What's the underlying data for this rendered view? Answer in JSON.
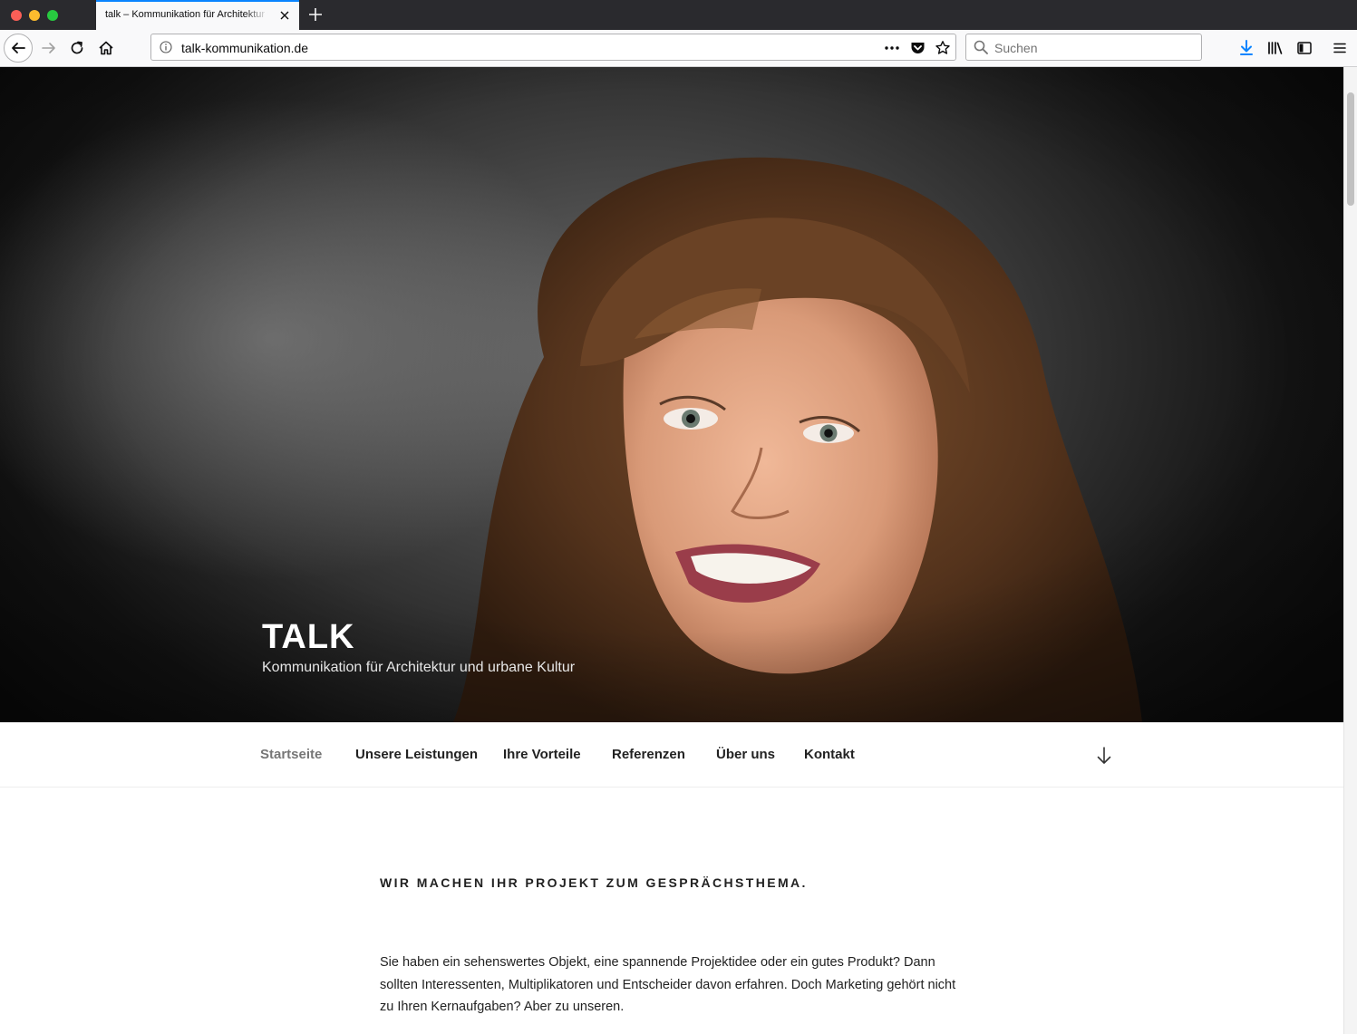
{
  "browser": {
    "tab_title": "talk – Kommunikation für Architektur und urbane Kultur",
    "url": "talk-kommunikation.de",
    "search_placeholder": "Suchen",
    "accent_color": "#0a84ff"
  },
  "site": {
    "title": "TALK",
    "description": "Kommunikation für Architektur und urbane Kultur"
  },
  "menu": {
    "items": [
      "Startseite",
      "Unsere Leistungen",
      "Ihre Vorteile",
      "Referenzen",
      "Über uns",
      "Kontakt"
    ],
    "current": "Startseite"
  },
  "content": {
    "heading": "WIR MACHEN IHR PROJEKT ZUM GESPRÄCHSTHEMA.",
    "paragraph": "Sie haben ein sehenswertes Objekt, eine spannende Projektidee oder ein gutes Produkt? Dann sollten Interessenten, Multiplikatoren und Entscheider davon erfahren. Doch Marketing gehört nicht zu Ihren Kernaufgaben? Aber zu unseren."
  }
}
